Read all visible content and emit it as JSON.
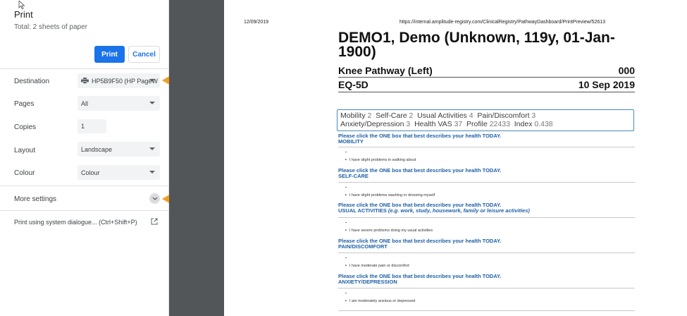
{
  "print_panel": {
    "title": "Print",
    "total": "Total: 2 sheets of paper",
    "print_button": "Print",
    "cancel_button": "Cancel",
    "destination": {
      "label": "Destination",
      "value": "HP5B9F50 (HP PageW"
    },
    "pages": {
      "label": "Pages",
      "value": "All"
    },
    "copies": {
      "label": "Copies",
      "value": "1"
    },
    "layout": {
      "label": "Layout",
      "value": "Landscape"
    },
    "colour": {
      "label": "Colour",
      "value": "Colour"
    },
    "more_settings": "More settings",
    "system_dialog": "Print using system dialogue... (Ctrl+Shift+P)"
  },
  "preview": {
    "date": "12/09/2019",
    "url": "https://internal.amplitude-registry.com/ClinicalRegistry/PathwayDashboard/PrintPreview/52613",
    "patient": "DEMO1, Demo (Unknown, 119y, 01-Jan-1900)",
    "pathway": "Knee Pathway (Left)",
    "pathway_number": "000",
    "form": "EQ-5D",
    "form_date": "10 Sep 2019",
    "summary": {
      "mobility_label": "Mobility",
      "mobility": "2",
      "selfcare_label": "Self-Care",
      "selfcare": "2",
      "usual_label": "Usual Activities",
      "usual": "4",
      "pain_label": "Pain/Discomfort",
      "pain": "3",
      "anxiety_label": "Anxiety/Depression",
      "anxiety": "3",
      "vas_label": "Health VAS",
      "vas": "37",
      "profile_label": "Profile",
      "profile": "22433",
      "index_label": "Index",
      "index": "0.438"
    },
    "prompt": "Please click the ONE box that best describes your health TODAY.",
    "questions": [
      {
        "heading": "MOBILITY",
        "answer": "I have slight problems in walking about"
      },
      {
        "heading": "SELF-CARE",
        "answer": "I have slight problems washing or dressing myself"
      },
      {
        "heading": "USUAL ACTIVITIES",
        "heading_extra": "(e.g. work, study, housework, family or leisure activities)",
        "answer": "I have severe problems doing my usual activities"
      },
      {
        "heading": "PAIN/DISCOMFORT",
        "answer": "I have moderate pain or discomfort"
      },
      {
        "heading": "ANXIETY/DEPRESSION",
        "answer": "I am moderately anxious or depressed"
      }
    ]
  },
  "colors": {
    "accent": "#1a73e8",
    "annotation_arrow": "#f0a020",
    "gutter": "#525659",
    "question_blue": "#1d5fa6"
  }
}
